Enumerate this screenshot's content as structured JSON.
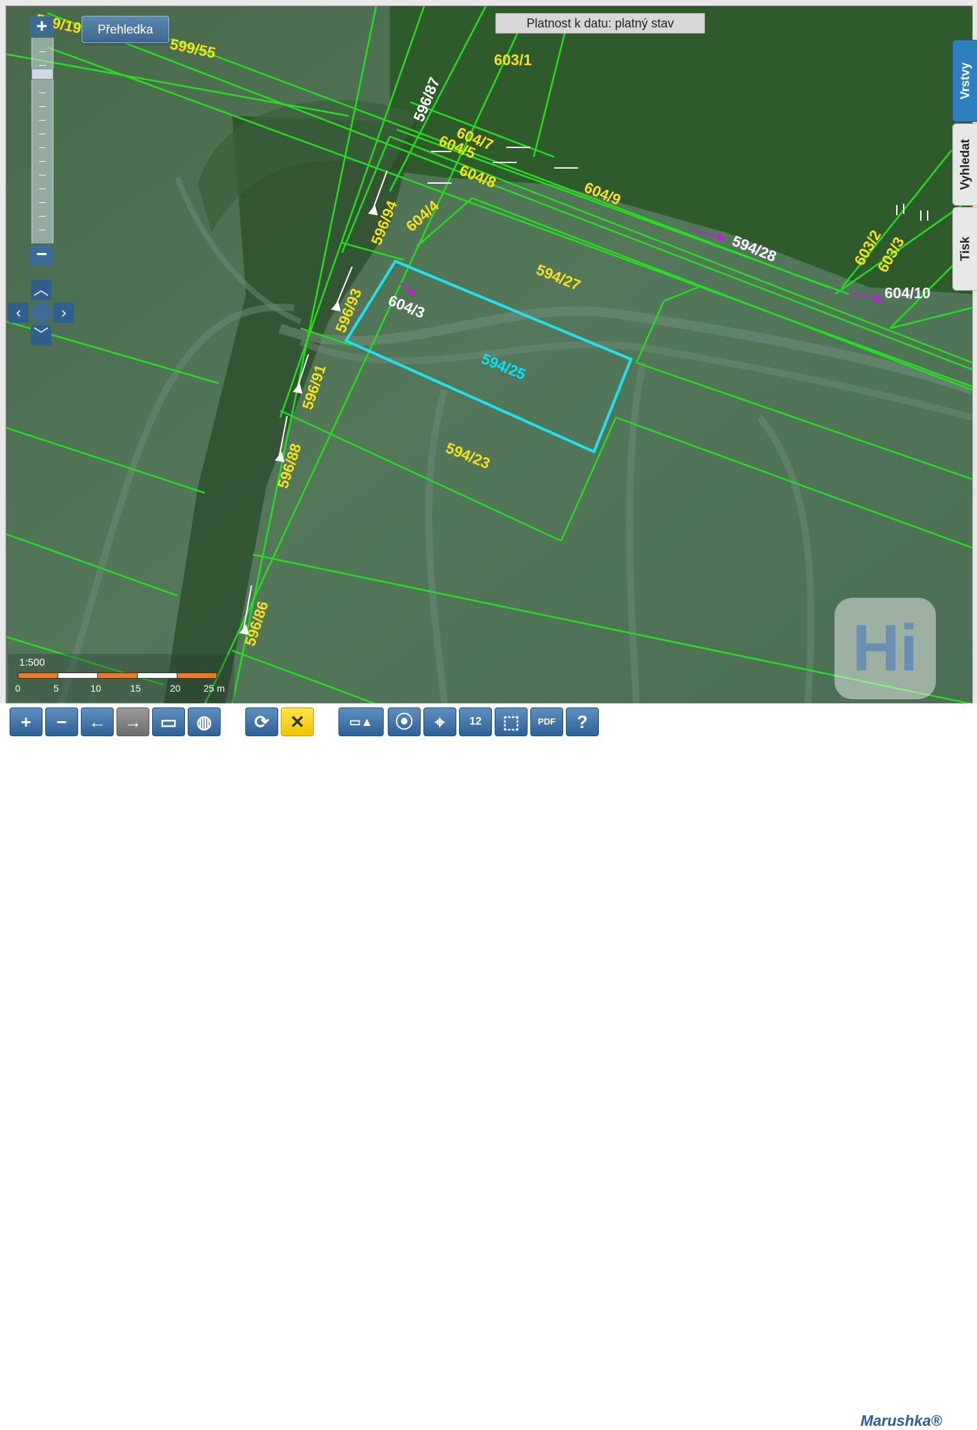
{
  "map": {
    "validity_label": "Platnost k datu: platný stav",
    "overview_button": "Přehledka",
    "zoom_in": "+",
    "zoom_out": "−",
    "parcels": [
      {
        "label": "599/19",
        "color": "#f7e11a",
        "rotate": 12
      },
      {
        "label": "599/55",
        "color": "#f7e11a",
        "rotate": 12
      },
      {
        "label": "603/1",
        "color": "#f7e11a",
        "rotate": 0
      },
      {
        "label": "596/87",
        "color": "#ffffff",
        "rotate": -68
      },
      {
        "label": "604/7",
        "color": "#f7e11a",
        "rotate": 22
      },
      {
        "label": "604/5",
        "color": "#f7e11a",
        "rotate": 22
      },
      {
        "label": "604/8",
        "color": "#f7e11a",
        "rotate": 22
      },
      {
        "label": "604/9",
        "color": "#f7e11a",
        "rotate": 22
      },
      {
        "label": "596/94",
        "color": "#f7e11a",
        "rotate": -68
      },
      {
        "label": "604/4",
        "color": "#f7e11a",
        "rotate": -42
      },
      {
        "label": "594/28",
        "color": "#ffffff",
        "rotate": 22
      },
      {
        "label": "603/2",
        "color": "#f7e11a",
        "rotate": -60
      },
      {
        "label": "603/3",
        "color": "#f7e11a",
        "rotate": -60
      },
      {
        "label": "604/10",
        "color": "#ffffff",
        "rotate": 0
      },
      {
        "label": "594/27",
        "color": "#f7e11a",
        "rotate": 22
      },
      {
        "label": "604/3",
        "color": "#ffffff",
        "rotate": 22
      },
      {
        "label": "596/93",
        "color": "#f7e11a",
        "rotate": -68
      },
      {
        "label": "594/25",
        "color": "#00e6ff",
        "rotate": 22
      },
      {
        "label": "596/91",
        "color": "#f7e11a",
        "rotate": -72
      },
      {
        "label": "594/23",
        "color": "#f7e11a",
        "rotate": 22
      },
      {
        "label": "596/88",
        "color": "#f7e11a",
        "rotate": -72
      },
      {
        "label": "596/86",
        "color": "#f7e11a",
        "rotate": -72
      }
    ],
    "selected_parcel": "594/25",
    "colors": {
      "boundary": "#22e01e",
      "selection": "#1ee2f0",
      "label": "#f7e11a"
    }
  },
  "side_tabs": [
    {
      "label": "Vrstvy",
      "active": true
    },
    {
      "label": "Vyhledat",
      "active": false
    },
    {
      "label": "Tisk",
      "active": false
    }
  ],
  "scale": {
    "ratio": "1:500",
    "ticks": [
      "0",
      "5",
      "10",
      "15",
      "20",
      "25 m"
    ]
  },
  "watermark": "Hi",
  "toolbar": {
    "buttons": [
      {
        "name": "zoom-in-button",
        "icon": "plus-icon",
        "glyph": "+"
      },
      {
        "name": "zoom-out-button",
        "icon": "minus-icon",
        "glyph": "−"
      },
      {
        "name": "back-button",
        "icon": "arrow-left-icon",
        "glyph": "←"
      },
      {
        "name": "forward-button",
        "icon": "arrow-right-icon",
        "glyph": "→"
      },
      {
        "name": "zoom-box-button",
        "icon": "rectangle-icon",
        "glyph": "▭"
      },
      {
        "name": "full-extent-button",
        "icon": "globe-icon",
        "glyph": "◍"
      },
      {
        "name": "refresh-button",
        "icon": "refresh-icon",
        "glyph": "⟳"
      },
      {
        "name": "clear-button",
        "icon": "close-icon",
        "glyph": "✕"
      },
      {
        "name": "measure-button",
        "icon": "ruler-icon",
        "glyph": "▭▲"
      },
      {
        "name": "gps-button",
        "icon": "gps-pin-icon",
        "glyph": "⦿"
      },
      {
        "name": "locate-button",
        "icon": "crosshair-icon",
        "glyph": "⌖"
      },
      {
        "name": "calendar-button",
        "icon": "calendar-icon",
        "glyph": "12"
      },
      {
        "name": "identify-button",
        "icon": "cursor-select-icon",
        "glyph": "⬚"
      },
      {
        "name": "pdf-button",
        "icon": "pdf-icon",
        "glyph": "PDF"
      },
      {
        "name": "help-button",
        "icon": "help-icon",
        "glyph": "?"
      }
    ]
  },
  "brand": "Marushka®"
}
